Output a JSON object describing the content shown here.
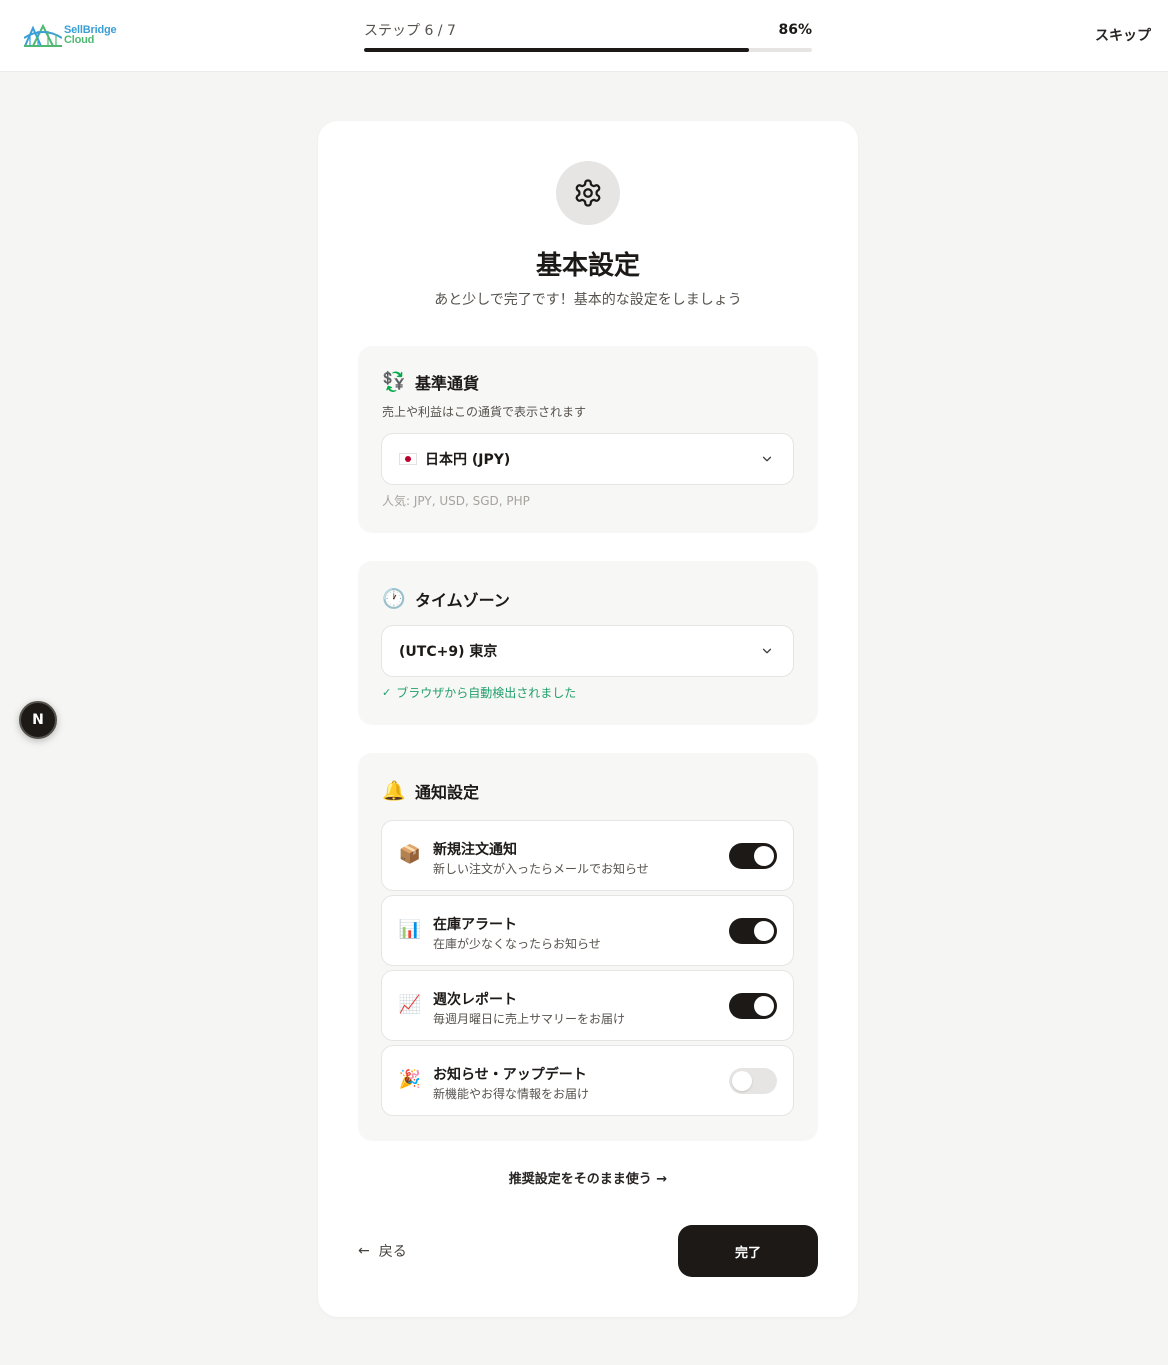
{
  "header": {
    "logo_line1": "SellBridge",
    "logo_line2": "Cloud",
    "step_label": "ステップ 6 / 7",
    "progress_percent_label": "86%",
    "progress_value": 0.86,
    "skip_label": "スキップ"
  },
  "floating_badge": "N",
  "page": {
    "title": "基本設定",
    "subtitle": "あと少しで完了です！基本的な設定をしましょう"
  },
  "currency": {
    "emoji": "💱",
    "title": "基準通貨",
    "description": "売上や利益はこの通貨で表示されます",
    "selected": "日本円 (JPY)",
    "hint": "人気: JPY, USD, SGD, PHP"
  },
  "timezone": {
    "emoji": "🕐",
    "title": "タイムゾーン",
    "selected": "(UTC+9) 東京",
    "check": "✓",
    "hint": "ブラウザから自動検出されました"
  },
  "notifications": {
    "emoji": "🔔",
    "title": "通知設定",
    "items": [
      {
        "emoji": "📦",
        "title": "新規注文通知",
        "description": "新しい注文が入ったらメールでお知らせ",
        "enabled": true
      },
      {
        "emoji": "📊",
        "title": "在庫アラート",
        "description": "在庫が少なくなったらお知らせ",
        "enabled": true
      },
      {
        "emoji": "📈",
        "title": "週次レポート",
        "description": "毎週月曜日に売上サマリーをお届け",
        "enabled": true
      },
      {
        "emoji": "🎉",
        "title": "お知らせ・アップデート",
        "description": "新機能やお得な情報をお届け",
        "enabled": false
      }
    ]
  },
  "actions": {
    "recommend": "推奨設定をそのまま使う →",
    "back_arrow": "←",
    "back": "戻る",
    "finish": "完了"
  },
  "colors": {
    "primary": "#1c1917",
    "success": "#22a06b",
    "page_bg": "#f5f5f4"
  }
}
